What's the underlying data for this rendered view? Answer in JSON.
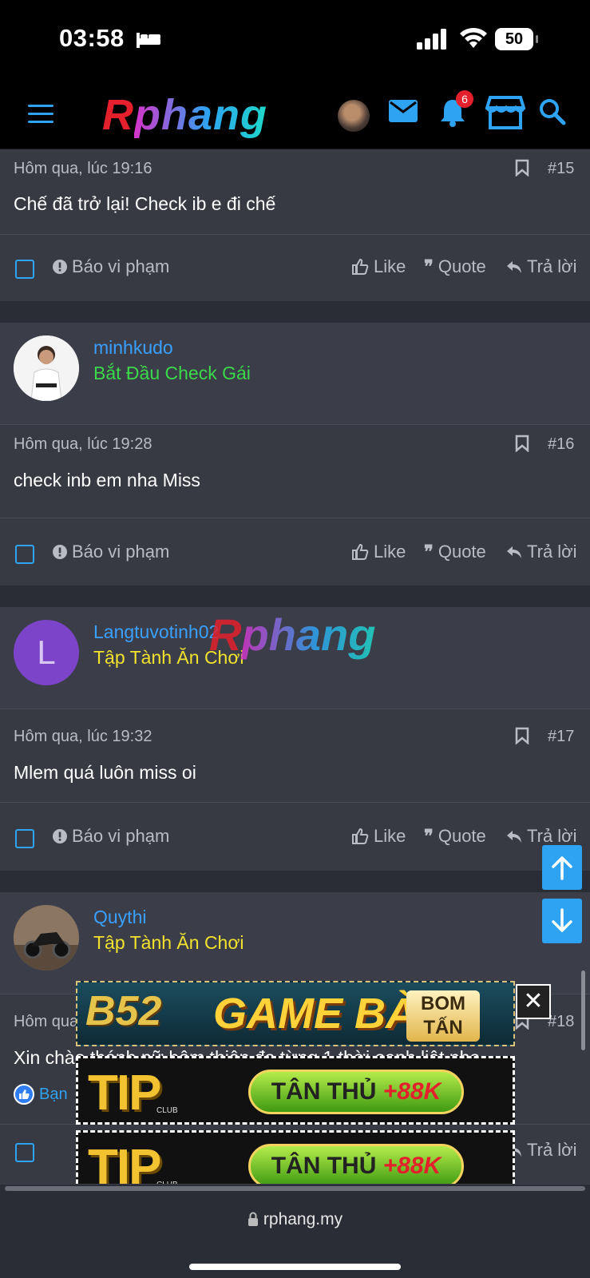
{
  "status": {
    "time": "03:58",
    "battery": "50"
  },
  "header": {
    "logo_r": "R",
    "logo_rest": "phang",
    "notification_count": "6"
  },
  "posts": [
    {
      "date": "Hôm qua, lúc 19:16",
      "num": "#15",
      "message": "Chế đã trở lại! Check ib e đi chế"
    },
    {
      "username": "minhkudo",
      "usertitle": "Bắt Đầu Check Gái",
      "date": "Hôm qua, lúc 19:28",
      "num": "#16",
      "message": "check inb em nha Miss"
    },
    {
      "username": "Langtuvotinh02",
      "usertitle": "Tập Tành Ăn Chơi",
      "avatar_letter": "L",
      "date": "Hôm qua, lúc 19:32",
      "num": "#17",
      "message": "Mlem quá luôn miss oi"
    },
    {
      "username": "Quythi",
      "usertitle": "Tập Tành Ăn Chơi",
      "date": "Hôm qua",
      "num": "#18",
      "message": "Xin chào thánh nữ hôm thiên đa từng 1 thời oanh liệt nha",
      "reaction": "Bạn"
    }
  ],
  "actions": {
    "report": "Báo vi phạm",
    "like": "Like",
    "quote": "Quote",
    "reply": "Trả lời"
  },
  "watermark": {
    "r": "R",
    "rest": "phang"
  },
  "ads": {
    "b52": {
      "brand": "B52",
      "title": "GAME BÀI",
      "badge": "BOM TẤN"
    },
    "tip": {
      "brand": "TIP",
      "sub": "CLUB",
      "pill_text": "TÂN THỦ",
      "pill_bonus": "+88K"
    },
    "close": "✕"
  },
  "urlbar": {
    "url": "rphang.my"
  },
  "colors": {
    "accent": "#2ea3f2",
    "username": "#3aa0ff",
    "green_title": "#3bd94a",
    "yellow_title": "#f2e22e"
  }
}
